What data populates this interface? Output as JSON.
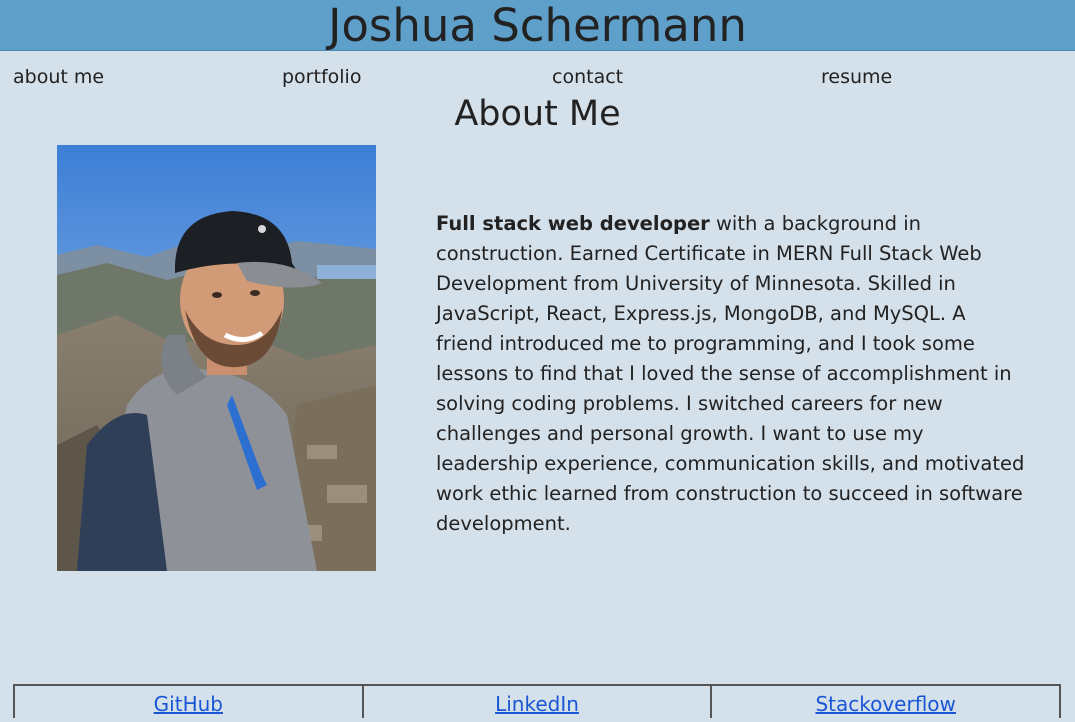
{
  "header": {
    "title": "Joshua Schermann",
    "background": "#5fa0cb"
  },
  "nav": {
    "items": [
      {
        "label": "about me"
      },
      {
        "label": "portfolio"
      },
      {
        "label": "contact"
      },
      {
        "label": "resume"
      }
    ]
  },
  "about": {
    "heading": "About Me",
    "photo_alt": "portrait-photo",
    "bio_bold": "Full stack web developer",
    "bio_rest": " with a background in construction. Earned Certificate in MERN Full Stack Web Development from University of Minnesota. Skilled in JavaScript, React, Express.js, MongoDB, and MySQL. A friend introduced me to programming, and I took some lessons to find that I loved the sense of accomplishment in solving coding problems. I switched careers for new challenges and personal growth. I want to use my leadership experience, communication skills, and motivated work ethic learned from construction to succeed in software development."
  },
  "footer": {
    "links": [
      {
        "label": "GitHub"
      },
      {
        "label": "LinkedIn"
      },
      {
        "label": "Stackoverflow"
      }
    ]
  },
  "colors": {
    "page_background": "#d4e0ea",
    "link": "#1a56d6"
  }
}
